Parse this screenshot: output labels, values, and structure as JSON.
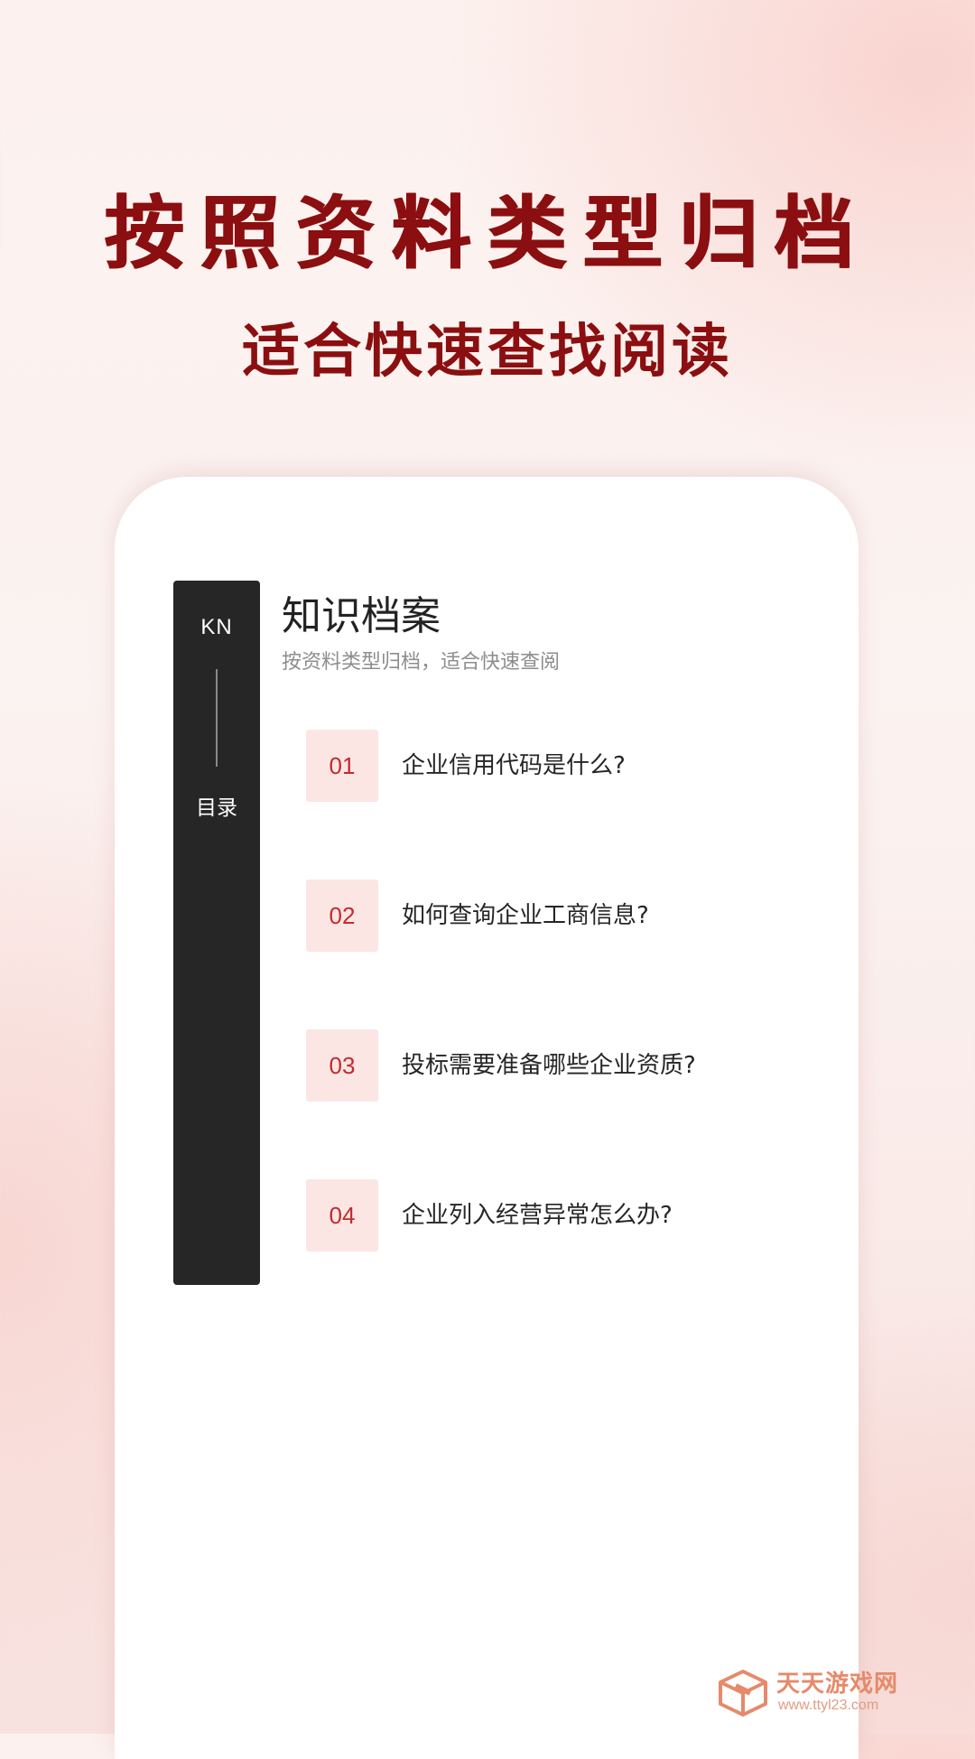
{
  "header": {
    "headline": "按照资料类型归档",
    "subheadline": "适合快速查找阅读"
  },
  "card": {
    "side_tab": {
      "badge": "KN",
      "label": "目录"
    },
    "title": "知识档案",
    "subtitle": "按资料类型归档，适合快速查阅",
    "items": [
      {
        "num": "01",
        "text": "企业信用代码是什么?"
      },
      {
        "num": "02",
        "text": "如何查询企业工商信息?"
      },
      {
        "num": "03",
        "text": "投标需要准备哪些企业资质?"
      },
      {
        "num": "04",
        "text": "企业列入经营异常怎么办?"
      }
    ]
  },
  "watermark": {
    "name": "天天游戏网",
    "url": "www.ttyl23.com",
    "icon": "cube-logo-icon"
  },
  "colors": {
    "headline": "#8b0f10",
    "side_tab_bg": "#262626",
    "number_bg": "#fbe6e4",
    "number_text": "#c42a2e",
    "watermark": "#e58a6b"
  }
}
